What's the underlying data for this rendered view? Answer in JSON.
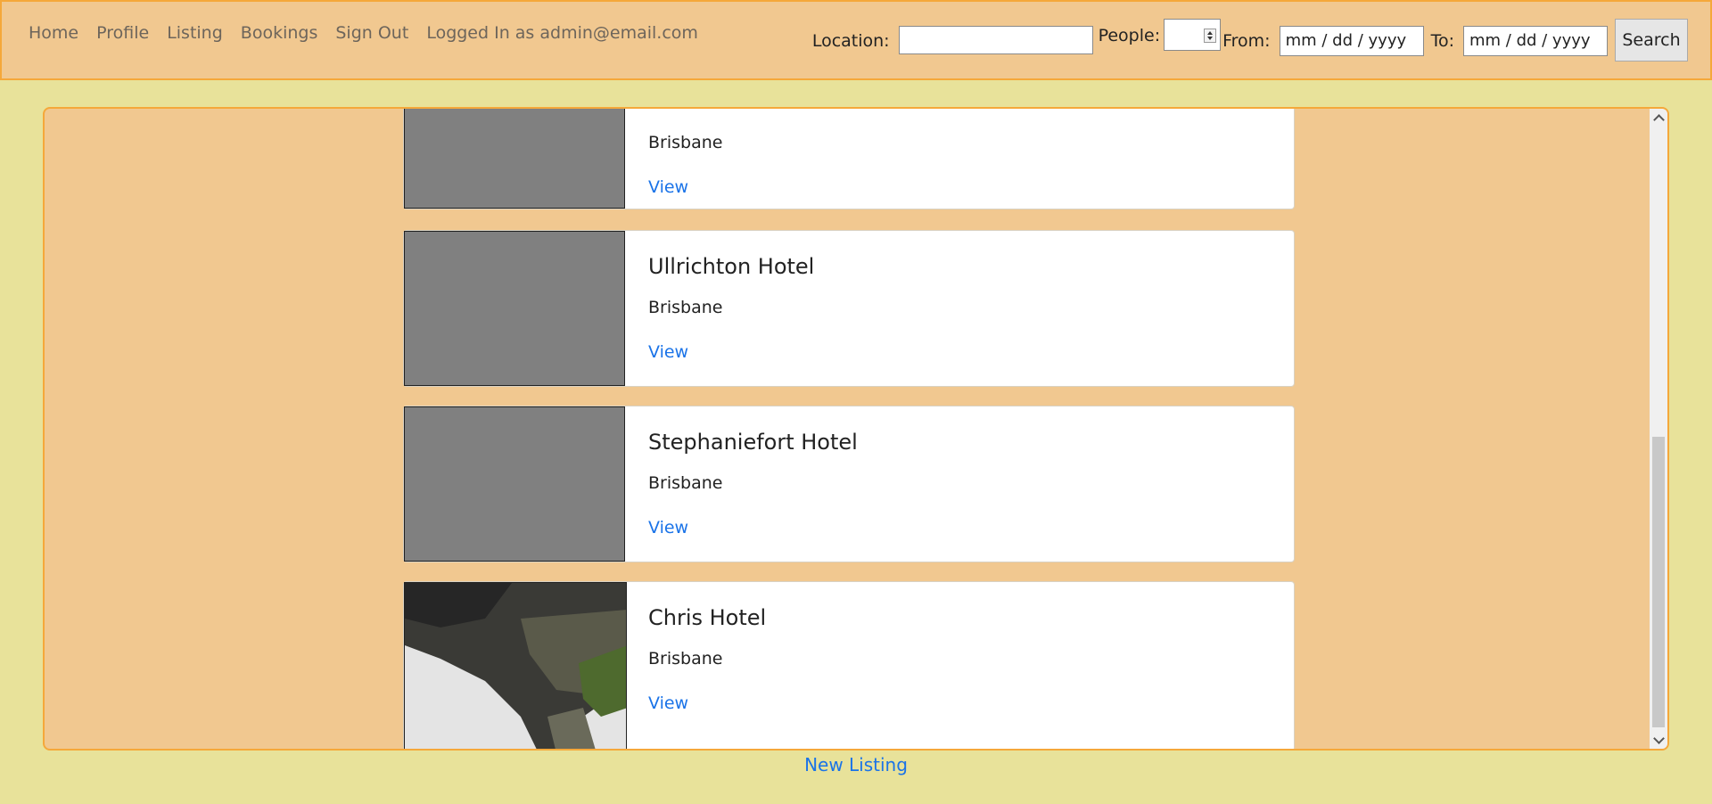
{
  "nav": {
    "links": [
      "Home",
      "Profile",
      "Listing",
      "Bookings",
      "Sign Out"
    ],
    "user_text": "Logged In as admin@email.com"
  },
  "search": {
    "location_label": "Location:",
    "location_value": "",
    "people_label": "People:",
    "people_value": "",
    "from_label": "From:",
    "from_value": "mm / dd / yyyy",
    "to_label": "To:",
    "to_value": "mm / dd / yyyy",
    "button_label": "Search"
  },
  "listings": [
    {
      "title": "",
      "location": "Brisbane",
      "link": "View",
      "image": "placeholder"
    },
    {
      "title": "Ullrichton Hotel",
      "location": "Brisbane",
      "link": "View",
      "image": "placeholder"
    },
    {
      "title": "Stephaniefort Hotel",
      "location": "Brisbane",
      "link": "View",
      "image": "placeholder"
    },
    {
      "title": "Chris Hotel",
      "location": "Brisbane",
      "link": "View",
      "image": "photo"
    }
  ],
  "footer": {
    "new_listing_label": "New Listing"
  },
  "colors": {
    "background": "#e8e29a",
    "panel": "#f1c890",
    "border_accent": "#f5a83a",
    "link": "#1a73e8"
  }
}
